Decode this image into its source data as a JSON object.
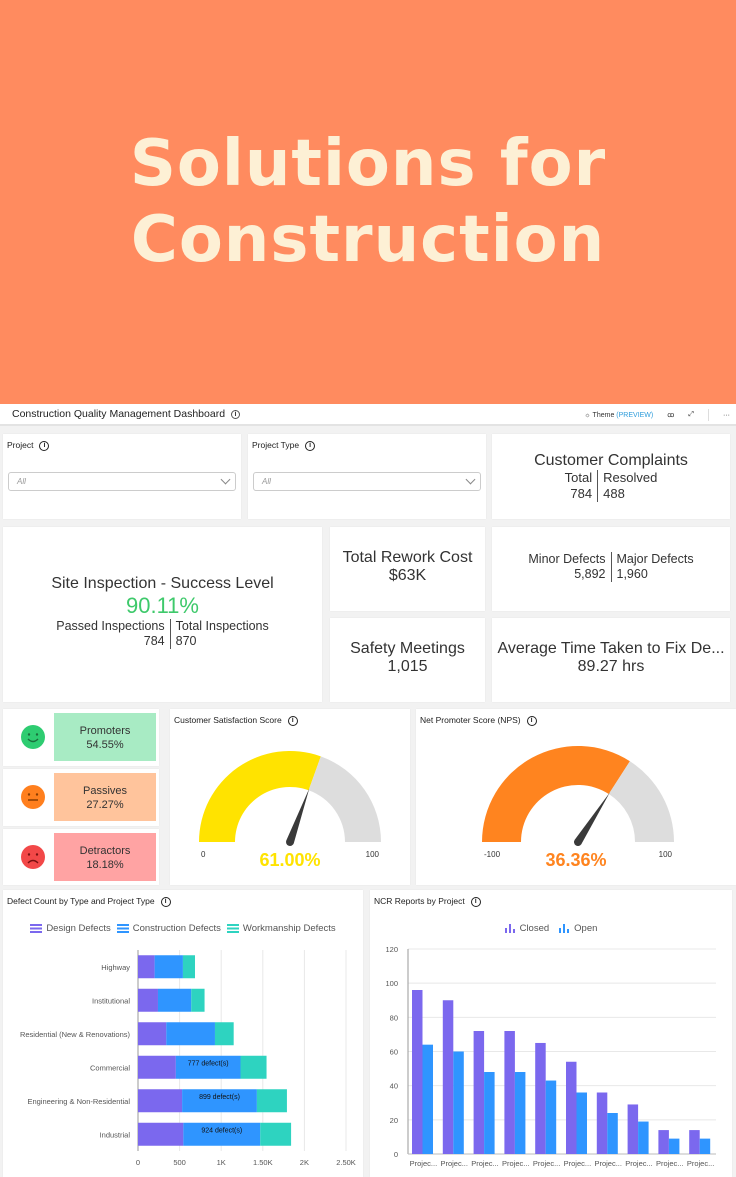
{
  "hero": {
    "line1": "Solutions for",
    "line2": "Construction",
    "bg_color": "#ff8b5f",
    "text_color": "#fdf0d5"
  },
  "topbar": {
    "title": "Construction Quality Management Dashboard",
    "theme_label": "Theme",
    "theme_preview": "(PREVIEW)",
    "icons": [
      "gear-icon",
      "glasses-icon",
      "expand-icon",
      "more-icon"
    ],
    "more_label": "···",
    "glasses_label": "ꝏ",
    "expand_label": "⤢"
  },
  "filters": [
    {
      "label": "Project",
      "value": "All"
    },
    {
      "label": "Project Type",
      "value": "All"
    }
  ],
  "kpis": {
    "complaints": {
      "title": "Customer Complaints",
      "left_label": "Total",
      "left_value": "784",
      "right_label": "Resolved",
      "right_value": "488"
    },
    "site_inspection": {
      "title": "Site Inspection - Success Level",
      "value": "90.11%",
      "value_color": "#3ec96b",
      "left_label": "Passed Inspections",
      "left_value": "784",
      "right_label": "Total Inspections",
      "right_value": "870"
    },
    "rework": {
      "title": "Total Rework Cost",
      "value": "$63K"
    },
    "defects": {
      "left_label": "Minor Defects",
      "left_value": "5,892",
      "right_label": "Major Defects",
      "right_value": "1,960"
    },
    "safety": {
      "title": "Safety Meetings",
      "value": "1,015"
    },
    "fix_time": {
      "title": "Average Time Taken to Fix De...",
      "value": "89.27 hrs"
    }
  },
  "nps_breakdown": [
    {
      "label": "Promoters",
      "value": "54.55%",
      "face": "smile",
      "face_color": "#2ecc71",
      "box_color": "#a8ebc4"
    },
    {
      "label": "Passives",
      "value": "27.27%",
      "face": "neutral",
      "face_color": "#ff7f1e",
      "box_color": "#ffc49c"
    },
    {
      "label": "Detractors",
      "value": "18.18%",
      "face": "sad",
      "face_color": "#f24848",
      "box_color": "#ffa3a3"
    }
  ],
  "gauges": [
    {
      "title": "Customer Satisfaction Score",
      "min": 0,
      "max": 100,
      "min_label": "0",
      "max_label": "100",
      "value": 61,
      "display": "61.00%",
      "color": "#ffe300"
    },
    {
      "title": "Net Promoter Score (NPS)",
      "min": -100,
      "max": 100,
      "min_label": "-100",
      "max_label": "100",
      "value": 36.36,
      "display": "36.36%",
      "color": "#ff841f"
    }
  ],
  "chart_data": [
    {
      "type": "bar",
      "orientation": "horizontal",
      "stacked": true,
      "title": "Defect Count by Type and Project Type",
      "categories": [
        "Highway",
        "Institutional",
        "Residential (New & Renovations)",
        "Commercial",
        "Engineering & Non-Residential",
        "Industrial"
      ],
      "series": [
        {
          "name": "Design Defects",
          "color": "#7b68ee",
          "values": [
            200,
            240,
            340,
            455,
            530,
            545
          ]
        },
        {
          "name": "Construction Defects",
          "color": "#2f95ff",
          "values": [
            340,
            400,
            585,
            777,
            899,
            924
          ]
        },
        {
          "name": "Workmanship Defects",
          "color": "#2ed3c0",
          "values": [
            145,
            160,
            225,
            313,
            361,
            371
          ]
        }
      ],
      "data_labels": {
        "3": "777 defect(s)",
        "4": "899 defect(s)",
        "5": "924 defect(s)"
      },
      "xlim": [
        0,
        2500
      ],
      "xticks": [
        0,
        500,
        1000,
        1500,
        2000,
        2500
      ],
      "xtick_labels": [
        "0",
        "500",
        "1K",
        "1.50K",
        "2K",
        "2.50K"
      ],
      "grid": true,
      "legend": "top-center"
    },
    {
      "type": "bar",
      "title": "NCR Reports by Project",
      "categories": [
        "Projec...",
        "Projec...",
        "Projec...",
        "Projec...",
        "Projec...",
        "Projec...",
        "Projec...",
        "Projec...",
        "Projec...",
        "Projec..."
      ],
      "series": [
        {
          "name": "Closed",
          "color": "#7b68ee",
          "values": [
            96,
            90,
            72,
            72,
            65,
            54,
            36,
            29,
            14,
            14
          ]
        },
        {
          "name": "Open",
          "color": "#2f95ff",
          "values": [
            64,
            60,
            48,
            48,
            43,
            36,
            24,
            19,
            9,
            9
          ]
        }
      ],
      "ylim": [
        0,
        120
      ],
      "yticks": [
        0,
        20,
        40,
        60,
        80,
        100,
        120
      ],
      "grid": true,
      "legend": "top-center"
    }
  ]
}
